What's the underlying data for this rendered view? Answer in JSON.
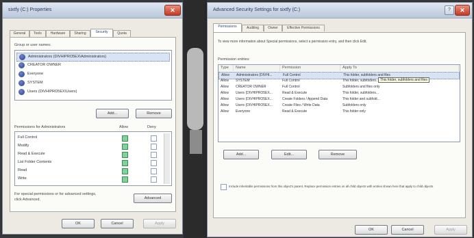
{
  "left_window": {
    "title": "sixtfy (C:) Properties",
    "close_glyph": "✕",
    "tabs": [
      "General",
      "Tools",
      "Hardware",
      "Sharing",
      "Security",
      "Quota"
    ],
    "active_tab": "Security",
    "groups_label": "Group or user names:",
    "groups": [
      "Administrators (DIVHIPRO5EX\\Administrators)",
      "CREATOR OWNER",
      "Everyone",
      "SYSTEM",
      "Users (DIVHIPRO5EX\\Users)"
    ],
    "add_button": "Add...",
    "remove_button": "Remove",
    "permissions_label": "Permissions for Administrators",
    "allow_label": "Allow",
    "deny_label": "Deny",
    "permissions": [
      {
        "name": "Full Control",
        "allow": true,
        "deny": false
      },
      {
        "name": "Modify",
        "allow": true,
        "deny": false
      },
      {
        "name": "Read & Execute",
        "allow": true,
        "deny": false
      },
      {
        "name": "List Folder Contents",
        "allow": true,
        "deny": false
      },
      {
        "name": "Read",
        "allow": true,
        "deny": false
      },
      {
        "name": "Write",
        "allow": true,
        "deny": false
      }
    ],
    "special_text_1": "For special permissions or for advanced settings,",
    "special_text_2": "click Advanced.",
    "advanced_button": "Advanced",
    "ok_button": "OK",
    "cancel_button": "Cancel",
    "apply_button": "Apply"
  },
  "right_window": {
    "title": "Advanced Security Settings for sixtfy (C:)",
    "help_glyph": "?",
    "close_glyph": "✕",
    "tabs": [
      "Permissions",
      "Auditing",
      "Owner",
      "Effective Permissions"
    ],
    "active_tab": "Permissions",
    "intro": "To view more information about Special permissions, select a permission entry, and then click Edit.",
    "entries_label": "Permission entries:",
    "columns": [
      "Type",
      "Name",
      "Permission",
      "Apply To"
    ],
    "entries": [
      [
        "Allow",
        "Administrators (DIVHI...",
        "Full Control",
        "This folder, subfolders and files"
      ],
      [
        "Allow",
        "SYSTEM",
        "Full Control",
        "This folder, subfolders..."
      ],
      [
        "Allow",
        "CREATOR OWNER",
        "Full Control",
        "Subfolders and files only"
      ],
      [
        "Allow",
        "Users (DIVHIPRO5EX...",
        "Read & Execute",
        "This folder, subfolders..."
      ],
      [
        "Allow",
        "Users (DIVHIPRO5EX...",
        "Create Folders / Append Data",
        "This folder and subfold..."
      ],
      [
        "Allow",
        "Users (DIVHIPRO5EX...",
        "Create Files / Write Data",
        "Subfolders only"
      ],
      [
        "Allow",
        "Everyone",
        "Read & Execute",
        "This folder only"
      ]
    ],
    "tooltip": "This folder, subfolders and files",
    "add_button": "Add...",
    "edit_button": "Edit...",
    "remove_button": "Remove",
    "inherit_text": "Include inheritable permissions from this object's parent. Replace permission entries on all child objects with entries shown here that apply to child objects",
    "ok_button": "OK",
    "cancel_button": "Cancel",
    "apply_button": "Apply"
  }
}
